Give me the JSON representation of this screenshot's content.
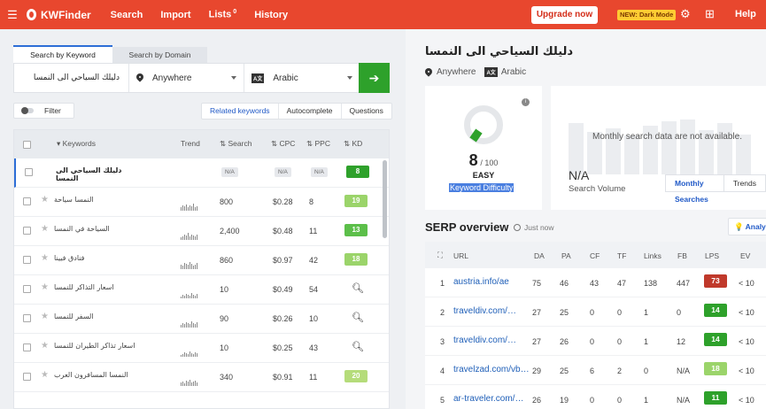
{
  "app": {
    "name": "KWFinder"
  },
  "nav": {
    "search": "Search",
    "import": "Import",
    "lists": "Lists",
    "lists_badge": "0",
    "history": "History",
    "upgrade": "Upgrade now",
    "dark_mode": "NEW: Dark Mode",
    "help": "Help"
  },
  "search_panel": {
    "tab_keyword": "Search by Keyword",
    "tab_domain": "Search by Domain",
    "keyword": "دليلك السياحي الى النمسا",
    "location": "Anywhere",
    "language": "Arabic",
    "lang_icon": "A文",
    "filter": "Filter",
    "modes": [
      "Related keywords",
      "Autocomplete",
      "Questions"
    ]
  },
  "table": {
    "headers": {
      "keywords": "Keywords",
      "trend": "Trend",
      "search": "Search",
      "cpc": "CPC",
      "ppc": "PPC",
      "kd": "KD"
    },
    "rows": [
      {
        "keyword": "دليلك السياحي الى النمسا",
        "search": "N/A",
        "cpc": "N/A",
        "ppc": "N/A",
        "kd": "8",
        "kd_color": "#2ea12b",
        "bold": true
      },
      {
        "keyword": "النمسا سياحة",
        "search": "800",
        "cpc": "$0.28",
        "ppc": "8",
        "kd": "19",
        "kd_color": "#9bd46a"
      },
      {
        "keyword": "السياحة في النمسا",
        "search": "2,400",
        "cpc": "$0.48",
        "ppc": "11",
        "kd": "13",
        "kd_color": "#5cbf4a"
      },
      {
        "keyword": "فنادق فيينا",
        "search": "860",
        "cpc": "$0.97",
        "ppc": "42",
        "kd": "18",
        "kd_color": "#9bd46a"
      },
      {
        "keyword": "اسعار التذاكر للنمسا",
        "search": "10",
        "cpc": "$0.49",
        "ppc": "54",
        "kd": "search"
      },
      {
        "keyword": "السفر للنمسا",
        "search": "90",
        "cpc": "$0.26",
        "ppc": "10",
        "kd": "search"
      },
      {
        "keyword": "اسعار تذاكر الطيران للنمسا",
        "search": "10",
        "cpc": "$0.25",
        "ppc": "43",
        "kd": "search"
      },
      {
        "keyword": "النمسا المسافرون العرب",
        "search": "340",
        "cpc": "$0.91",
        "ppc": "11",
        "kd": "20",
        "kd_color": "#b5dc7a"
      }
    ]
  },
  "detail": {
    "keyword": "دليلك السياحي الى النمسا",
    "location": "Anywhere",
    "language": "Arabic",
    "kd_value": "8",
    "kd_max": "/ 100",
    "kd_text": "EASY",
    "kd_label": "Keyword Difficulty",
    "sv_message": "Monthly search data are not available.",
    "sv_value": "N/A",
    "sv_label": "Search Volume",
    "sv_tabs": [
      "Monthly Searches",
      "Trends"
    ]
  },
  "serp": {
    "title": "SERP overview",
    "time": "Just now",
    "analyze": "Analyze",
    "headers": [
      "URL",
      "DA",
      "PA",
      "CF",
      "TF",
      "Links",
      "FB",
      "LPS",
      "EV"
    ],
    "rows": [
      {
        "n": "1",
        "url": "austria.info/ae",
        "da": "75",
        "pa": "46",
        "cf": "43",
        "tf": "47",
        "links": "138",
        "fb": "447",
        "lps": "73",
        "lps_color": "#c0392b",
        "ev": "< 10"
      },
      {
        "n": "2",
        "url": "traveldiv.com/…",
        "da": "27",
        "pa": "25",
        "cf": "0",
        "tf": "0",
        "links": "1",
        "fb": "0",
        "lps": "14",
        "lps_color": "#2ea12b",
        "ev": "< 10"
      },
      {
        "n": "3",
        "url": "traveldiv.com/…",
        "da": "27",
        "pa": "26",
        "cf": "0",
        "tf": "0",
        "links": "1",
        "fb": "12",
        "lps": "14",
        "lps_color": "#2ea12b",
        "ev": "< 10"
      },
      {
        "n": "4",
        "url": "travelzad.com/vb…",
        "da": "29",
        "pa": "25",
        "cf": "6",
        "tf": "2",
        "links": "0",
        "fb": "N/A",
        "lps": "18",
        "lps_color": "#9bd46a",
        "ev": "< 10"
      },
      {
        "n": "5",
        "url": "ar-traveler.com/…",
        "da": "26",
        "pa": "19",
        "cf": "0",
        "tf": "0",
        "links": "1",
        "fb": "N/A",
        "lps": "11",
        "lps_color": "#2ea12b",
        "ev": "< 10"
      }
    ]
  }
}
